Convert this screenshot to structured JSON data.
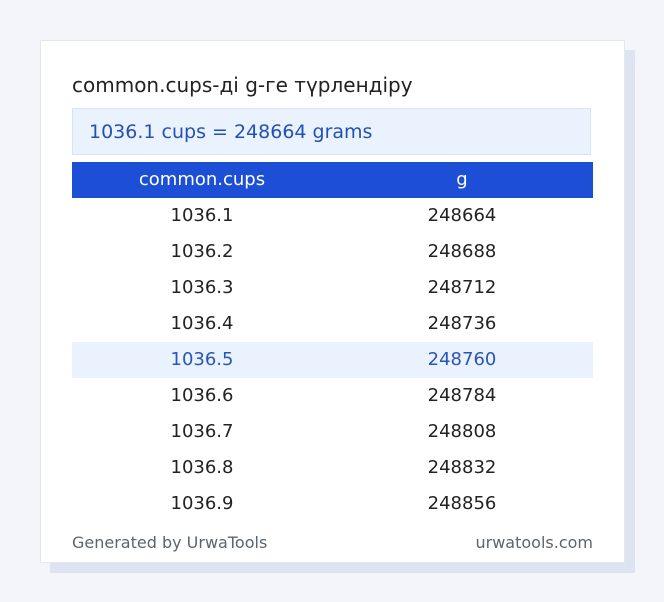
{
  "title": "common.cups-ді g-ге түрлендіру",
  "result": "1036.1 cups = 248664 grams",
  "table": {
    "headers": [
      "common.cups",
      "g"
    ],
    "rows": [
      [
        "1036.1",
        "248664"
      ],
      [
        "1036.2",
        "248688"
      ],
      [
        "1036.3",
        "248712"
      ],
      [
        "1036.4",
        "248736"
      ],
      [
        "1036.5",
        "248760"
      ],
      [
        "1036.6",
        "248784"
      ],
      [
        "1036.7",
        "248808"
      ],
      [
        "1036.8",
        "248832"
      ],
      [
        "1036.9",
        "248856"
      ]
    ],
    "highlighted_row": 4
  },
  "footer": {
    "generated_by": "Generated by UrwaTools",
    "site": "urwatools.com"
  },
  "colors": {
    "header_bg": "#1c4fd6",
    "highlight_bg": "#eaf3fd",
    "result_text": "#2350b4"
  }
}
